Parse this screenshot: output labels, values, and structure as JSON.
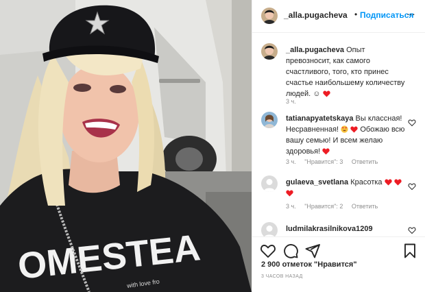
{
  "header": {
    "username": "_alla.pugacheva",
    "separator": "•",
    "follow_label": "Подписаться",
    "more_label": "···"
  },
  "photo": {
    "shirt_text": "OMESTEA",
    "shirt_small_text": "with love fro"
  },
  "caption": {
    "username": "_alla.pugacheva",
    "text": "Опыт превозносит, как самого счастливого, того, кто принес счастье наибольшему количеству людей. ☺",
    "time": "3 ч."
  },
  "comments": [
    {
      "username": "tatianapyatetskaya",
      "text_a": "Вы классная! Несравненная!",
      "text_b": "Обожаю всю вашу семью! И всем желаю здоровья!",
      "time": "3 ч.",
      "likes": "\"Нравится\": 3",
      "reply": "Ответить"
    },
    {
      "username": "gulaeva_svetlana",
      "text_a": "Красотка",
      "time": "3 ч.",
      "likes": "\"Нравится\": 2",
      "reply": "Ответить"
    },
    {
      "username": "ludmilakrasilnikova1209",
      "text_a": ""
    }
  ],
  "footer": {
    "likes_count": "2 900 отметок \"Нравится\"",
    "time_ago": "3 часов назад"
  },
  "colors": {
    "link_blue": "#0095f6",
    "heart_red": "#ed1c24",
    "muted": "#8e8e8e"
  },
  "icons": [
    "more-icon",
    "heart-icon",
    "comment-icon",
    "share-icon",
    "bookmark-icon"
  ]
}
